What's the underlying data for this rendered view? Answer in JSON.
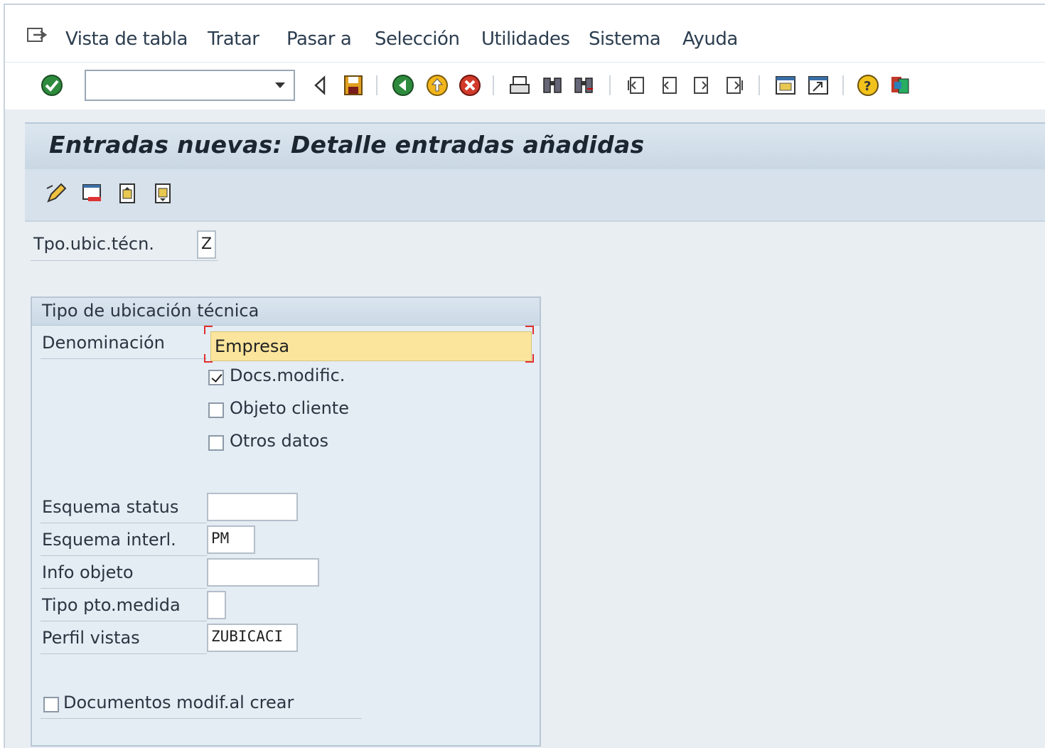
{
  "menu": {
    "items": [
      "Vista de tabla",
      "Tratar",
      "Pasar a",
      "Selección",
      "Utilidades",
      "Sistema",
      "Ayuda"
    ]
  },
  "toolbar": {
    "command_value": "",
    "icons": [
      "enter-icon",
      "back-icon",
      "save-icon",
      "back-green-icon",
      "exit-icon",
      "cancel-icon",
      "print-icon",
      "find-icon",
      "find-next-icon",
      "first-page-icon",
      "previous-page-icon",
      "next-page-icon",
      "last-page-icon",
      "create-session-icon",
      "shortcut-icon",
      "help-icon",
      "layout-icon"
    ]
  },
  "title": "Entradas nuevas: Detalle entradas añadidas",
  "app_toolbar": {
    "icons": [
      "display-change-icon",
      "delete-icon",
      "previous-entry-icon",
      "next-entry-icon"
    ]
  },
  "header_field": {
    "label": "Tpo.ubic.técn.",
    "value": "Z"
  },
  "group": {
    "title": "Tipo de ubicación técnica",
    "denominacion_label": "Denominación",
    "denominacion_value": "Empresa",
    "checkboxes": [
      {
        "label": "Docs.modific.",
        "checked": true
      },
      {
        "label": "Objeto cliente",
        "checked": false
      },
      {
        "label": "Otros datos",
        "checked": false
      }
    ],
    "fields": [
      {
        "label": "Esquema status",
        "value": ""
      },
      {
        "label": "Esquema interl.",
        "value": "PM"
      },
      {
        "label": "Info objeto",
        "value": ""
      },
      {
        "label": "Tipo pto.medida",
        "value": ""
      },
      {
        "label": "Perfil vistas",
        "value": "ZUBICACI"
      }
    ],
    "bottom_checkbox": {
      "label": "Documentos modif.al crear",
      "checked": false
    }
  }
}
